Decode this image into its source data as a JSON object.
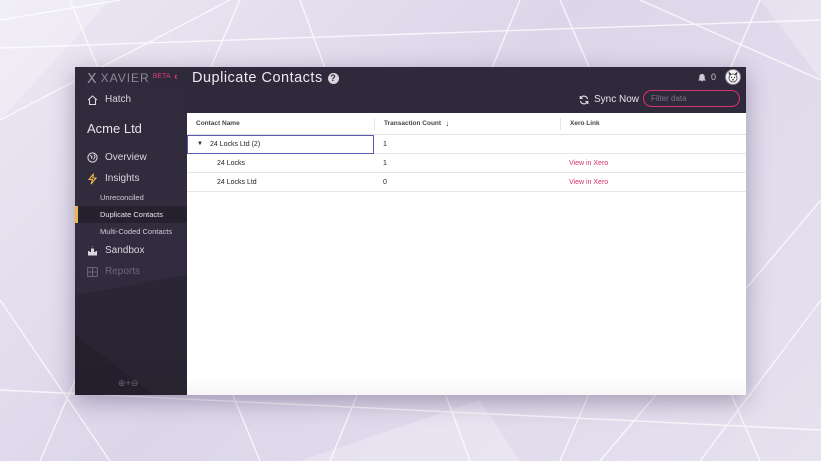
{
  "app": {
    "brand": "XAVIER",
    "brand_tag": "BETA",
    "colors": {
      "accent": "#d9336f",
      "sidebar": "#2f2a3b",
      "active_marker": "#e8b84a",
      "link": "#d6336c"
    }
  },
  "sidebar": {
    "hatch_label": "Hatch",
    "org_name": "Acme Ltd",
    "items": [
      {
        "label": "Overview",
        "icon": "globe-icon"
      },
      {
        "label": "Insights",
        "icon": "lightning-icon"
      },
      {
        "label": "Sandbox",
        "icon": "sandcastle-icon"
      },
      {
        "label": "Reports",
        "icon": "table-icon"
      }
    ],
    "insights_sub": [
      {
        "label": "Unreconciled"
      },
      {
        "label": "Duplicate Contacts",
        "active": true
      },
      {
        "label": "Multi-Coded Contacts"
      }
    ],
    "footer": "⊕+⊖"
  },
  "header": {
    "title": "Duplicate Contacts",
    "notification_count": "0",
    "sync_label": "Sync Now",
    "filter_placeholder": "Filter data"
  },
  "table": {
    "columns": [
      "Contact Name",
      "Transaction Count",
      "Xero Link"
    ],
    "sort_indicator": "↓",
    "group": {
      "name": "24 Locks Ltd (2)",
      "count": "1"
    },
    "rows": [
      {
        "name": "24 Locks",
        "count": "1",
        "link": "View in Xero"
      },
      {
        "name": "24 Locks Ltd",
        "count": "0",
        "link": "View in Xero"
      }
    ]
  }
}
